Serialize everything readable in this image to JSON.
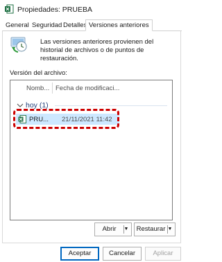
{
  "window": {
    "title": "Propiedades: PRUEBA",
    "icon": "excel-file-icon"
  },
  "tabs": [
    {
      "label": "General",
      "active": false
    },
    {
      "label": "Seguridad",
      "active": false
    },
    {
      "label": "Detalles",
      "active": false
    },
    {
      "label": "Versiones anteriores",
      "active": true
    }
  ],
  "info": {
    "icon": "restore-points-icon",
    "text": "Las versiones anteriores provienen del historial de archivos o de puntos de restauración."
  },
  "section_label": "Versión del archivo:",
  "list": {
    "columns": [
      "Nombre",
      "Fecha de modificació..."
    ],
    "column_display": [
      "Nomb...",
      "Fecha de modificaci..."
    ],
    "group": {
      "title": "hoy (1)",
      "icon": "chevron-down-icon"
    },
    "rows": [
      {
        "name": "PRU...",
        "date": "21/11/2021 11:42",
        "icon": "excel-file-icon",
        "selected": true
      }
    ]
  },
  "buttons": {
    "open": "Abrir",
    "restore": "Restaurar",
    "ok": "Aceptar",
    "cancel": "Cancelar",
    "apply": "Aplicar"
  },
  "colors": {
    "accent": "#0067c0",
    "selection": "#cde8ff",
    "highlight": "#cc0000",
    "excel": "#1d6f42"
  }
}
